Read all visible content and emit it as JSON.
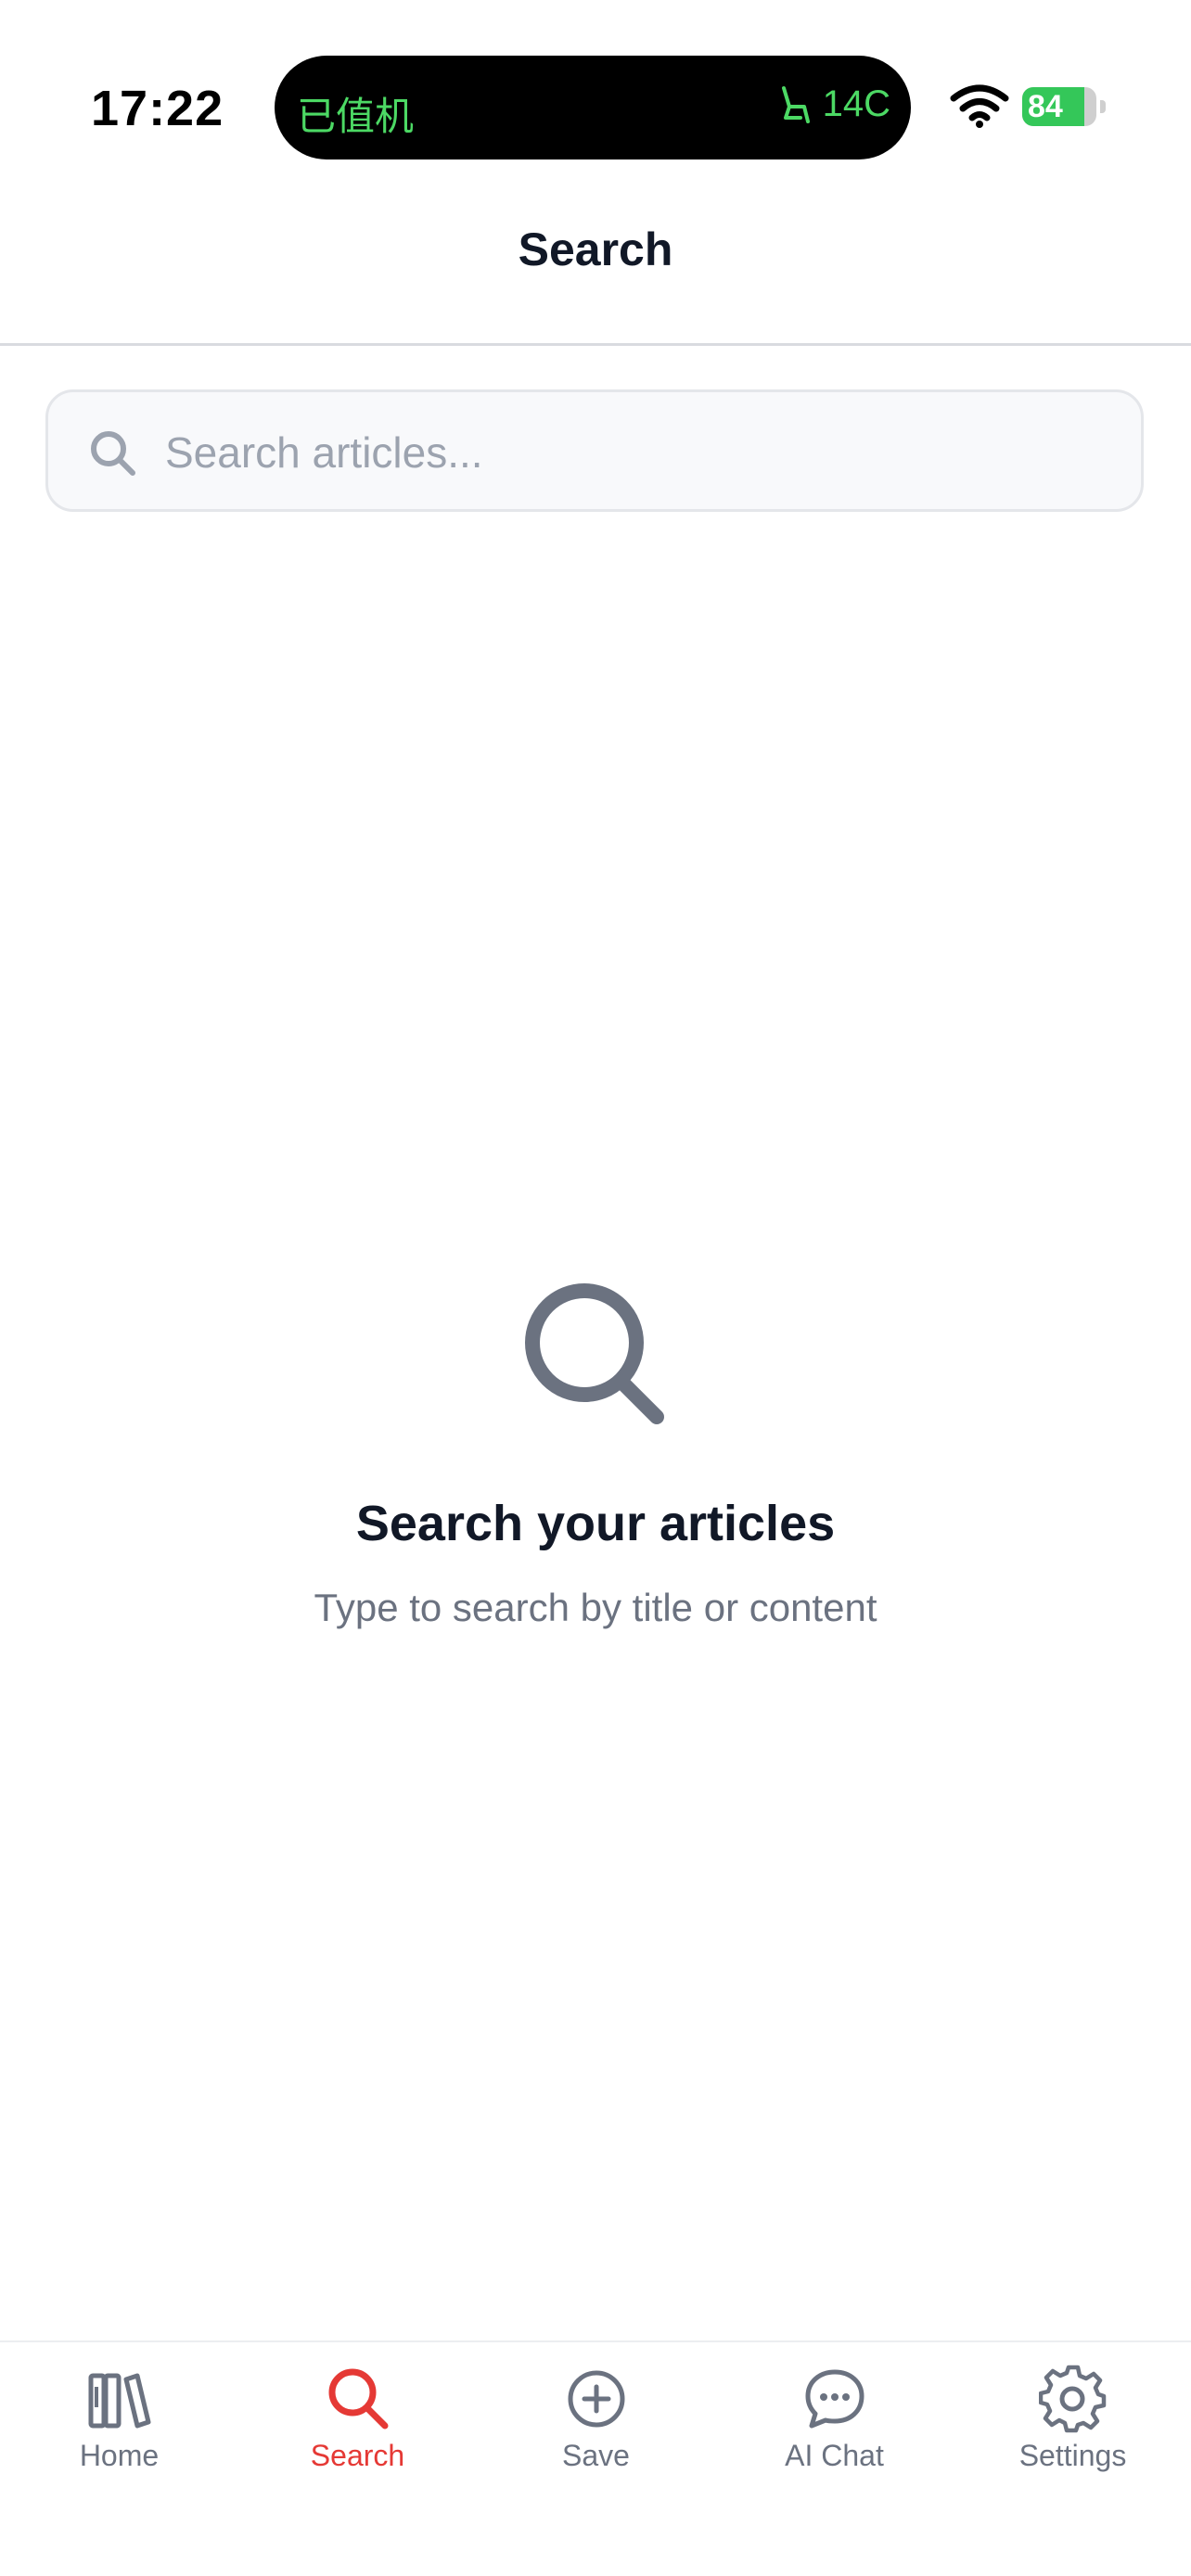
{
  "status_bar": {
    "time": "17:22",
    "island_left": "已值机",
    "island_right": "14C",
    "battery": "84",
    "battery_level": 0.84
  },
  "header": {
    "title": "Search"
  },
  "search": {
    "placeholder": "Search articles...",
    "value": ""
  },
  "empty_state": {
    "icon": "search-icon",
    "title": "Search your articles",
    "subtitle": "Type to search by title or content"
  },
  "tab_bar": {
    "active": "Search",
    "active_color": "#e53935",
    "tabs": [
      {
        "label": "Home",
        "icon": "books-icon"
      },
      {
        "label": "Search",
        "icon": "search-icon"
      },
      {
        "label": "Save",
        "icon": "plus-circle-icon"
      },
      {
        "label": "AI Chat",
        "icon": "chat-bubble-icon"
      },
      {
        "label": "Settings",
        "icon": "gear-icon"
      }
    ]
  }
}
